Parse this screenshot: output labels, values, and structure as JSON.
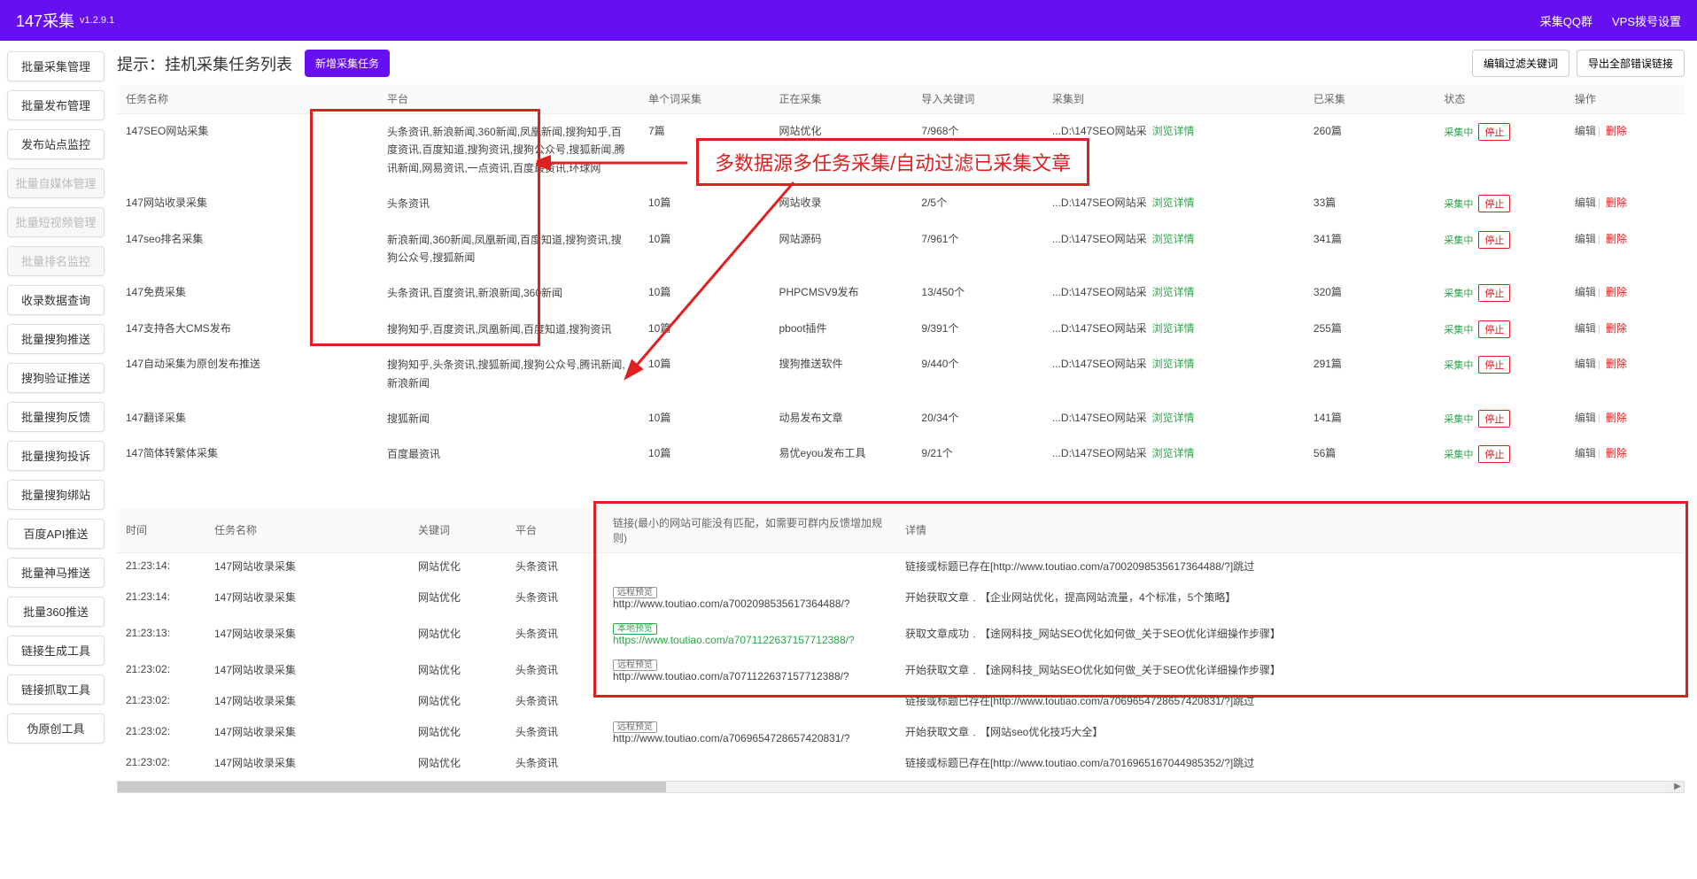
{
  "header": {
    "title": "147采集",
    "version": "v1.2.9.1",
    "links": {
      "qq": "采集QQ群",
      "vps": "VPS拨号设置"
    }
  },
  "sidebar": {
    "items": [
      {
        "label": "批量采集管理",
        "disabled": false
      },
      {
        "label": "批量发布管理",
        "disabled": false
      },
      {
        "label": "发布站点监控",
        "disabled": false
      },
      {
        "label": "批量自媒体管理",
        "disabled": true
      },
      {
        "label": "批量短视频管理",
        "disabled": true
      },
      {
        "label": "批量排名监控",
        "disabled": true
      },
      {
        "label": "收录数据查询",
        "disabled": false
      },
      {
        "label": "批量搜狗推送",
        "disabled": false
      },
      {
        "label": "搜狗验证推送",
        "disabled": false
      },
      {
        "label": "批量搜狗反馈",
        "disabled": false
      },
      {
        "label": "批量搜狗投诉",
        "disabled": false
      },
      {
        "label": "批量搜狗绑站",
        "disabled": false
      },
      {
        "label": "百度API推送",
        "disabled": false
      },
      {
        "label": "批量神马推送",
        "disabled": false
      },
      {
        "label": "批量360推送",
        "disabled": false
      },
      {
        "label": "链接生成工具",
        "disabled": false
      },
      {
        "label": "链接抓取工具",
        "disabled": false
      },
      {
        "label": "伪原创工具",
        "disabled": false
      }
    ]
  },
  "page": {
    "title": "提示：挂机采集任务列表",
    "add_btn": "新增采集任务",
    "filter_btn": "编辑过滤关键词",
    "export_btn": "导出全部错误链接"
  },
  "annotation": {
    "callout": "多数据源多任务采集/自动过滤已采集文章"
  },
  "tasks": {
    "headers": {
      "name": "任务名称",
      "platform": "平台",
      "single": "单个词采集",
      "collecting": "正在采集",
      "import_kw": "导入关键词",
      "collect_to": "采集到",
      "collected": "已采集",
      "status": "状态",
      "op": "操作"
    },
    "browse_label": "浏览详情",
    "status_label": "采集中",
    "stop_label": "停止",
    "edit_label": "编辑",
    "delete_label": "删除",
    "rows": [
      {
        "name": "147SEO网站采集",
        "platform": "头条资讯,新浪新闻,360新闻,凤凰新闻,搜狗知乎,百度资讯,百度知道,搜狗资讯,搜狗公众号,搜狐新闻,腾讯新闻,网易资讯,一点资讯,百度最资讯,环球网",
        "single": "7篇",
        "collecting": "网站优化",
        "import_kw": "7/968个",
        "collect_to": "...D:\\147SEO网站采",
        "collected": "260篇"
      },
      {
        "name": "147网站收录采集",
        "platform": "头条资讯",
        "single": "10篇",
        "collecting": "网站收录",
        "import_kw": "2/5个",
        "collect_to": "...D:\\147SEO网站采",
        "collected": "33篇"
      },
      {
        "name": "147seo排名采集",
        "platform": "新浪新闻,360新闻,凤凰新闻,百度知道,搜狗资讯,搜狗公众号,搜狐新闻",
        "single": "10篇",
        "collecting": "网站源码",
        "import_kw": "7/961个",
        "collect_to": "...D:\\147SEO网站采",
        "collected": "341篇"
      },
      {
        "name": "147免费采集",
        "platform": "头条资讯,百度资讯,新浪新闻,360新闻",
        "single": "10篇",
        "collecting": "PHPCMSV9发布",
        "import_kw": "13/450个",
        "collect_to": "...D:\\147SEO网站采",
        "collected": "320篇"
      },
      {
        "name": "147支持各大CMS发布",
        "platform": "搜狗知乎,百度资讯,凤凰新闻,百度知道,搜狗资讯",
        "single": "10篇",
        "collecting": "pboot插件",
        "import_kw": "9/391个",
        "collect_to": "...D:\\147SEO网站采",
        "collected": "255篇"
      },
      {
        "name": "147自动采集为原创发布推送",
        "platform": "搜狗知乎,头条资讯,搜狐新闻,搜狗公众号,腾讯新闻,新浪新闻",
        "single": "10篇",
        "collecting": "搜狗推送软件",
        "import_kw": "9/440个",
        "collect_to": "...D:\\147SEO网站采",
        "collected": "291篇"
      },
      {
        "name": "147翻译采集",
        "platform": "搜狐新闻",
        "single": "10篇",
        "collecting": "动易发布文章",
        "import_kw": "20/34个",
        "collect_to": "...D:\\147SEO网站采",
        "collected": "141篇"
      },
      {
        "name": "147简体转繁体采集",
        "platform": "百度最资讯",
        "single": "10篇",
        "collecting": "易优eyou发布工具",
        "import_kw": "9/21个",
        "collect_to": "...D:\\147SEO网站采",
        "collected": "56篇"
      }
    ]
  },
  "logs": {
    "headers": {
      "time": "时间",
      "task": "任务名称",
      "keyword": "关键词",
      "platform": "平台",
      "link": "链接(最小的网站可能没有匹配，如需要可群内反馈增加规则)",
      "detail": "详情"
    },
    "remote_tag": "远程预览",
    "local_tag": "本地预览",
    "rows": [
      {
        "time": "21:23:14:",
        "task": "147网站收录采集",
        "keyword": "网站优化",
        "platform": "头条资讯",
        "link_type": "",
        "link": "",
        "detail": "链接或标题已存在[http://www.toutiao.com/a7002098535617364488/?]跳过"
      },
      {
        "time": "21:23:14:",
        "task": "147网站收录采集",
        "keyword": "网站优化",
        "platform": "头条资讯",
        "link_type": "remote",
        "link": "http://www.toutiao.com/a7002098535617364488/?",
        "detail": "开始获取文章﹒【企业网站优化，提高网站流量，4个标准，5个策略】"
      },
      {
        "time": "21:23:13:",
        "task": "147网站收录采集",
        "keyword": "网站优化",
        "platform": "头条资讯",
        "link_type": "local",
        "link": "https://www.toutiao.com/a7071122637157712388/?",
        "detail": "获取文章成功﹒【途网科技_网站SEO优化如何做_关于SEO优化详细操作步骤】"
      },
      {
        "time": "21:23:02:",
        "task": "147网站收录采集",
        "keyword": "网站优化",
        "platform": "头条资讯",
        "link_type": "remote",
        "link": "http://www.toutiao.com/a7071122637157712388/?",
        "detail": "开始获取文章﹒【途网科技_网站SEO优化如何做_关于SEO优化详细操作步骤】"
      },
      {
        "time": "21:23:02:",
        "task": "147网站收录采集",
        "keyword": "网站优化",
        "platform": "头条资讯",
        "link_type": "",
        "link": "",
        "detail": "链接或标题已存在[http://www.toutiao.com/a7069654728657420831/?]跳过"
      },
      {
        "time": "21:23:02:",
        "task": "147网站收录采集",
        "keyword": "网站优化",
        "platform": "头条资讯",
        "link_type": "remote",
        "link": "http://www.toutiao.com/a7069654728657420831/?",
        "detail": "开始获取文章﹒【网站seo优化技巧大全】"
      },
      {
        "time": "21:23:02:",
        "task": "147网站收录采集",
        "keyword": "网站优化",
        "platform": "头条资讯",
        "link_type": "",
        "link": "",
        "detail": "链接或标题已存在[http://www.toutiao.com/a7016965167044985352/?]跳过"
      }
    ]
  }
}
